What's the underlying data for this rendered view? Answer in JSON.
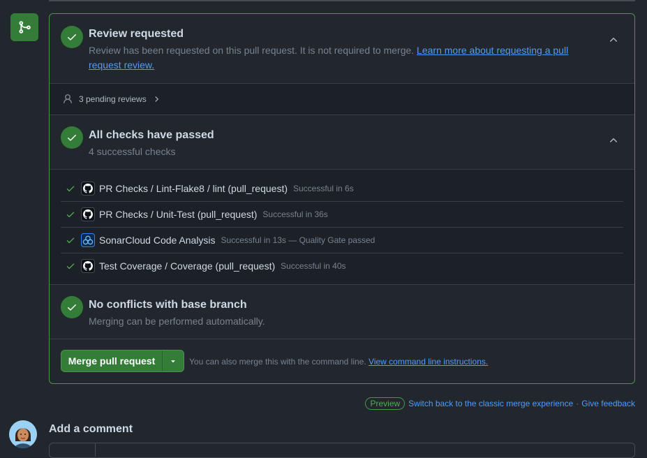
{
  "review": {
    "title": "Review requested",
    "desc": "Review has been requested on this pull request. It is not required to merge.",
    "link": "Learn more about requesting a pull request review.",
    "pending": "3 pending reviews"
  },
  "checks": {
    "title": "All checks have passed",
    "summary": "4 successful checks",
    "items": [
      {
        "name": "PR Checks / Lint-Flake8 / lint (pull_request)",
        "status": "Successful in 6s",
        "app": "github-icon"
      },
      {
        "name": "PR Checks / Unit-Test (pull_request)",
        "status": "Successful in 36s",
        "app": "github-icon"
      },
      {
        "name": "SonarCloud Code Analysis",
        "status": "Successful in 13s — Quality Gate passed",
        "app": "sonarcloud-icon"
      },
      {
        "name": "Test Coverage / Coverage (pull_request)",
        "status": "Successful in 40s",
        "app": "github-icon"
      }
    ]
  },
  "conflicts": {
    "title": "No conflicts with base branch",
    "desc": "Merging can be performed automatically."
  },
  "merge": {
    "button": "Merge pull request",
    "note": "You can also merge this with the command line.",
    "link": "View command line instructions."
  },
  "footer": {
    "preview": "Preview",
    "switch": "Switch back to the classic merge experience",
    "sep": "·",
    "feedback": "Give feedback"
  },
  "comment": {
    "title": "Add a comment"
  },
  "colors": {
    "success": "#347d39",
    "link": "#539bf5",
    "background": "#22272e"
  }
}
